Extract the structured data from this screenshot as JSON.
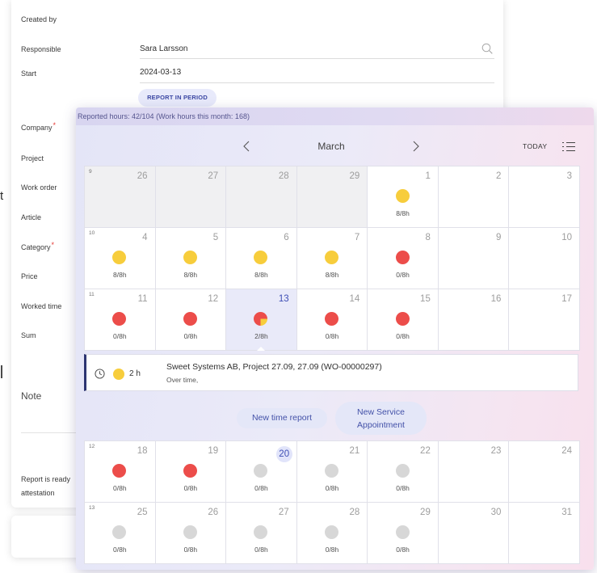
{
  "edge_fragment": "t",
  "icons": {
    "search": "search-icon",
    "prev": "chevron-left-icon",
    "next": "chevron-right-icon",
    "view": "list-icon",
    "clock": "clock-icon"
  },
  "colors": {
    "accent": "#3f4fb5",
    "required": "#e53935",
    "event_border": "#2d3572"
  },
  "form": {
    "required_mark": "*",
    "created_by_label": "Created by",
    "responsible_label": "Responsible",
    "responsible_value": "Sara Larsson",
    "start_label": "Start",
    "start_value": "2024-03-13",
    "report_in_period": "REPORT IN PERIOD",
    "company_label": "Company",
    "project_label": "Project",
    "work_order_label": "Work order",
    "article_label": "Article",
    "category_label": "Category",
    "price_label": "Price",
    "worked_time_label": "Worked time",
    "sum_label": "Sum",
    "note_label": "Note",
    "report_ready_line1": "Report is ready",
    "report_ready_line2": "attestation"
  },
  "calendar": {
    "reported_hours": "Reported hours: 42/104 (Work hours this month: 168)",
    "month": "March",
    "today_label": "TODAY",
    "weeks": [
      {
        "week": "9",
        "days": [
          {
            "day": "26",
            "other_month": true
          },
          {
            "day": "27",
            "other_month": true
          },
          {
            "day": "28",
            "other_month": true
          },
          {
            "day": "29",
            "other_month": true
          },
          {
            "day": "1",
            "dot": "#f7cd3c",
            "hours": "8/8h"
          },
          {
            "day": "2"
          },
          {
            "day": "3"
          }
        ]
      },
      {
        "week": "10",
        "days": [
          {
            "day": "4",
            "dot": "#f7cd3c",
            "hours": "8/8h"
          },
          {
            "day": "5",
            "dot": "#f7cd3c",
            "hours": "8/8h"
          },
          {
            "day": "6",
            "dot": "#f7cd3c",
            "hours": "8/8h"
          },
          {
            "day": "7",
            "dot": "#f7cd3c",
            "hours": "8/8h"
          },
          {
            "day": "8",
            "dot": "#ec4d4a",
            "hours": "0/8h"
          },
          {
            "day": "9"
          },
          {
            "day": "10"
          }
        ]
      },
      {
        "week": "11",
        "days": [
          {
            "day": "11",
            "dot": "#ec4d4a",
            "hours": "0/8h"
          },
          {
            "day": "12",
            "dot": "#ec4d4a",
            "hours": "0/8h"
          },
          {
            "day": "13",
            "dot": "#ec4d4a",
            "dot_fill": "#f7cd3c",
            "fill": 0.25,
            "hours": "2/8h",
            "selected": true
          },
          {
            "day": "14",
            "dot": "#ec4d4a",
            "hours": "0/8h"
          },
          {
            "day": "15",
            "dot": "#ec4d4a",
            "hours": "0/8h"
          },
          {
            "day": "16"
          },
          {
            "day": "17"
          }
        ]
      },
      {
        "week": "12",
        "days": [
          {
            "day": "18",
            "dot": "#ec4d4a",
            "hours": "0/8h"
          },
          {
            "day": "19",
            "dot": "#ec4d4a",
            "hours": "0/8h"
          },
          {
            "day": "20",
            "dot": "#d7d7d7",
            "hours": "0/8h",
            "today": true
          },
          {
            "day": "21",
            "dot": "#d7d7d7",
            "hours": "0/8h"
          },
          {
            "day": "22",
            "dot": "#d7d7d7",
            "hours": "0/8h"
          },
          {
            "day": "23"
          },
          {
            "day": "24"
          }
        ]
      },
      {
        "week": "13",
        "days": [
          {
            "day": "25",
            "dot": "#d7d7d7",
            "hours": "0/8h"
          },
          {
            "day": "26",
            "dot": "#d7d7d7",
            "hours": "0/8h"
          },
          {
            "day": "27",
            "dot": "#d7d7d7",
            "hours": "0/8h"
          },
          {
            "day": "28",
            "dot": "#d7d7d7",
            "hours": "0/8h"
          },
          {
            "day": "29",
            "dot": "#d7d7d7",
            "hours": "0/8h"
          },
          {
            "day": "30"
          },
          {
            "day": "31"
          }
        ]
      }
    ],
    "event": {
      "dot": "#f7cd3c",
      "duration": "2 h",
      "title": "Sweet Systems AB, Project 27.09, 27.09 (WO-00000297)",
      "note": "Over time,"
    },
    "actions": {
      "new_time_report": "New time report",
      "new_service_appointment": "New Service Appointment"
    }
  }
}
